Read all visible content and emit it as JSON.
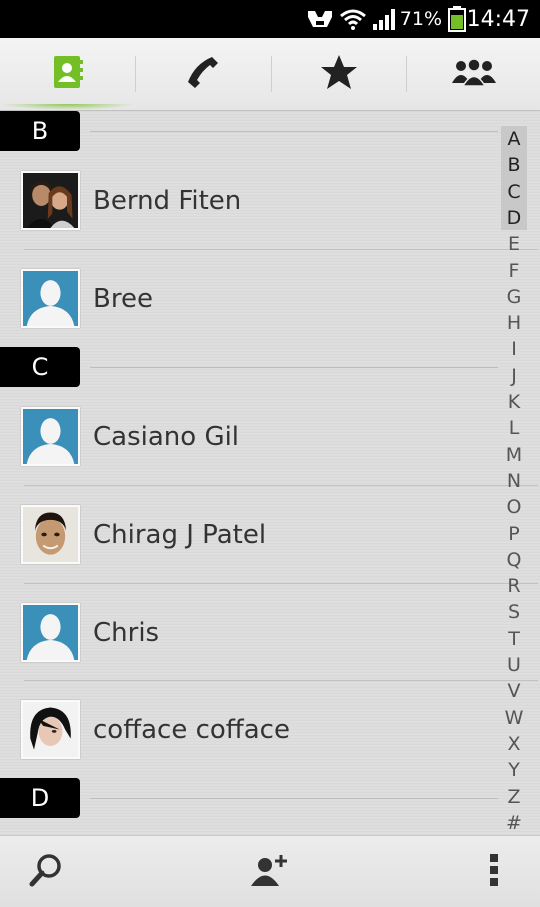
{
  "status_bar": {
    "battery_percent": "71%",
    "time": "14:47",
    "icons": [
      "notification-icon",
      "wifi-icon",
      "signal-icon",
      "battery-icon"
    ]
  },
  "tabs": [
    {
      "name": "contacts",
      "icon": "contacts-book-icon",
      "selected": true
    },
    {
      "name": "phone",
      "icon": "phone-icon",
      "selected": false
    },
    {
      "name": "favorites",
      "icon": "star-icon",
      "selected": false
    },
    {
      "name": "groups",
      "icon": "groups-icon",
      "selected": false
    }
  ],
  "sections": [
    {
      "letter": "B",
      "contacts": [
        {
          "name": "Bernd Fiten",
          "photo": "couple-photo"
        },
        {
          "name": "Bree",
          "photo": "default-avatar"
        }
      ]
    },
    {
      "letter": "C",
      "contacts": [
        {
          "name": "Casiano Gil",
          "photo": "default-avatar"
        },
        {
          "name": "Chirag J Patel",
          "photo": "face-photo"
        },
        {
          "name": "Chris",
          "photo": "default-avatar"
        },
        {
          "name": "cofface cofface",
          "photo": "dark-hair-photo"
        }
      ]
    },
    {
      "letter": "D",
      "contacts": []
    }
  ],
  "index": [
    "A",
    "B",
    "C",
    "D",
    "E",
    "F",
    "G",
    "H",
    "I",
    "J",
    "K",
    "L",
    "M",
    "N",
    "O",
    "P",
    "Q",
    "R",
    "S",
    "T",
    "U",
    "V",
    "W",
    "X",
    "Y",
    "Z",
    "#"
  ],
  "index_highlighted": [
    "A",
    "B",
    "C",
    "D"
  ],
  "bottom_bar": {
    "search_icon": "search-icon",
    "add_icon": "add-contact-icon",
    "menu_icon": "overflow-menu-icon"
  },
  "colors": {
    "accent_green": "#74be28",
    "avatar_blue": "#3a90b8"
  }
}
